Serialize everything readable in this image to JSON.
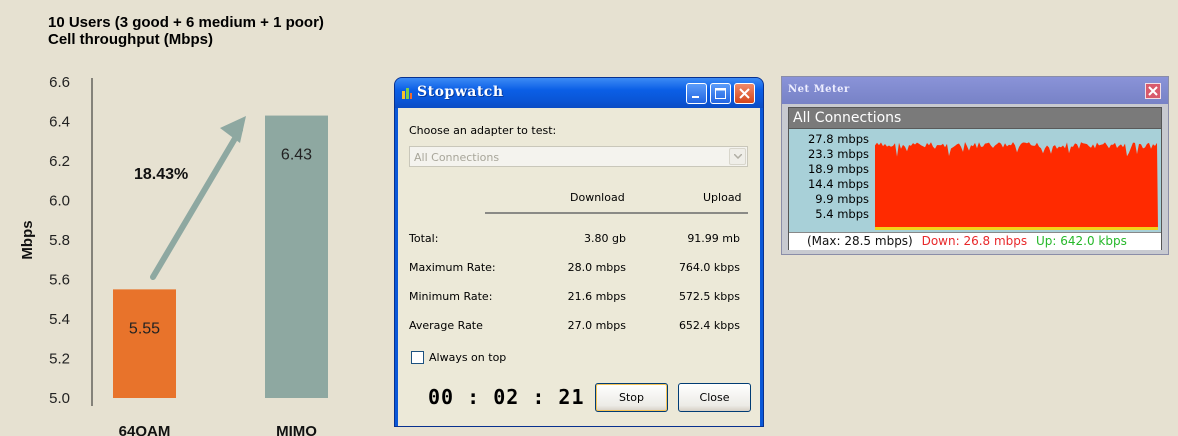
{
  "chart": {
    "title_line1": "10 Users (3 good + 6 medium + 1 poor)",
    "title_line2": "Cell throughput (Mbps)",
    "annotation": "18.43%",
    "colors": {
      "bar_64qam": "#e8732b",
      "bar_mimo": "#8ea8a1",
      "arrow": "#8ea8a1"
    }
  },
  "chart_data": {
    "type": "bar",
    "title": "10 Users (3 good + 6 medium + 1 poor)\nCell throughput (Mbps)",
    "categories": [
      "64QAM",
      "MIMO"
    ],
    "values": [
      5.55,
      6.43
    ],
    "value_labels": [
      "5.55",
      "6.43"
    ],
    "xlabel": "",
    "ylabel": "Mbps",
    "ylim": [
      5.0,
      6.6
    ],
    "yticks": [
      "5.0",
      "5.2",
      "5.4",
      "5.6",
      "5.8",
      "6.0",
      "6.2",
      "6.4",
      "6.6"
    ],
    "annotation": "18.43%",
    "grid": false,
    "legend": "none"
  },
  "stopwatch": {
    "title": "Stopwatch",
    "adapter_label": "Choose an adapter to test:",
    "adapter_value": "All Connections",
    "col_download": "Download",
    "col_upload": "Upload",
    "rows": [
      {
        "label": "Total:",
        "download": "3.80 gb",
        "upload": "91.99 mb"
      },
      {
        "label": "Maximum Rate:",
        "download": "28.0 mbps",
        "upload": "764.0 kbps"
      },
      {
        "label": "Minimum Rate:",
        "download": "21.6 mbps",
        "upload": "572.5 kbps"
      },
      {
        "label": "Average Rate",
        "download": "27.0 mbps",
        "upload": "652.4 kbps"
      }
    ],
    "always_on_top_label": "Always on top",
    "always_on_top_checked": false,
    "timer": "00 : 02 : 21",
    "stop_label": "Stop",
    "close_label": "Close"
  },
  "netmeter": {
    "title": "Net Meter",
    "header_label": "All Connections",
    "y_labels": [
      "27.8 mbps",
      "23.3 mbps",
      "18.9 mbps",
      "14.4 mbps",
      "9.9 mbps",
      "5.4 mbps"
    ],
    "status_max": "(Max: 28.5 mbps)",
    "status_down": "Down: 26.8 mbps",
    "status_up": "Up: 642.0 kbps",
    "colors": {
      "down": "#e8282a",
      "up": "#26b82a",
      "graph_fill": "#ff2a00"
    }
  }
}
